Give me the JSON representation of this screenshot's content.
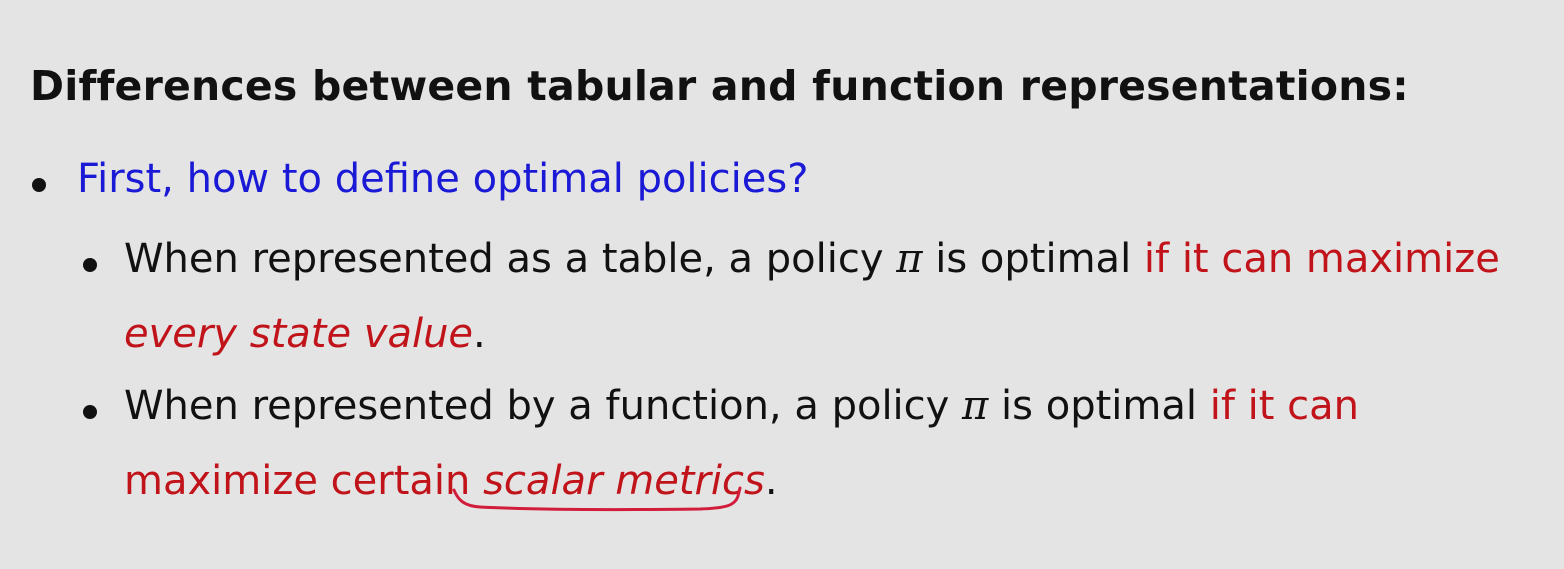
{
  "heading": "Differences between tabular and function representations:",
  "bullet1": {
    "text": "First, how to define optimal policies?"
  },
  "sub1": {
    "part1": "When represented as a table, a policy ",
    "symbol": "π",
    "part2": " is optimal ",
    "red1": "if it can maximize",
    "red_italic": "every state value",
    "end": "."
  },
  "sub2": {
    "part1": "When represented by a function, a policy ",
    "symbol": "π",
    "part2": " is optimal ",
    "red1": "if it can",
    "red2": "maximize certain ",
    "red_italic": "scalar metrics",
    "end": "."
  },
  "colors": {
    "background": "#e5e4e4",
    "blue": "#1a1ad6",
    "red": "#c0131a",
    "annotation": "#d21c3c"
  }
}
